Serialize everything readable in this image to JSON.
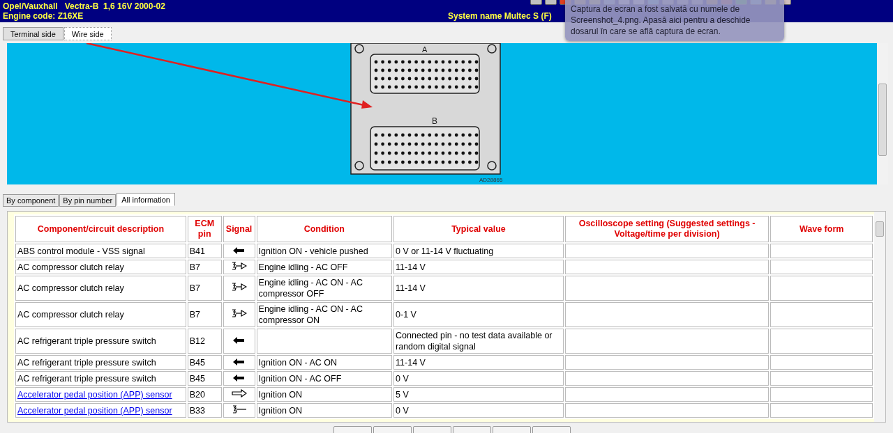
{
  "header": {
    "vehicle": "Opel/Vauxhall   Vectra-B  1,6 16V 2000-02",
    "engine_code": "Engine code: Z16XE",
    "system_name": "System name Multec S (F)"
  },
  "notification": {
    "text": "Captura de ecran a fost salvată cu numele de Screenshot_4.png. Apasă aici pentru a deschide dosarul în care se află captura de ecran."
  },
  "view_tabs": [
    {
      "label": "Terminal side",
      "selected": false
    },
    {
      "label": "Wire side",
      "selected": true
    }
  ],
  "connector": {
    "label_a": "A",
    "label_b": "B",
    "drawing_code": "AD28865"
  },
  "info_tabs": [
    {
      "label": "By component",
      "selected": false
    },
    {
      "label": "By pin number",
      "selected": false
    },
    {
      "label": "All information",
      "selected": true
    }
  ],
  "table": {
    "columns": [
      "Component/circuit description",
      "ECM pin",
      "Signal",
      "Condition",
      "Typical value",
      "Oscilloscope setting (Suggested settings - Voltage/time per division)",
      "Wave form"
    ],
    "rows": [
      {
        "description": "ABS control module - VSS signal",
        "link": false,
        "pin": "B41",
        "kind": "input",
        "condition": "Ignition ON - vehicle pushed",
        "typical": "0 V or 11-14 V fluctuating"
      },
      {
        "description": "AC compressor clutch relay",
        "link": false,
        "pin": "B7",
        "kind": "switched",
        "condition": "Engine idling - AC OFF",
        "typical": "11-14 V"
      },
      {
        "description": "AC compressor clutch relay",
        "link": false,
        "pin": "B7",
        "kind": "switched",
        "condition": "Engine idling - AC ON - AC compressor OFF",
        "typical": "11-14 V"
      },
      {
        "description": "AC compressor clutch relay",
        "link": false,
        "pin": "B7",
        "kind": "switched",
        "condition": "Engine idling - AC ON - AC compressor ON",
        "typical": "0-1 V"
      },
      {
        "description": "AC refrigerant triple pressure switch",
        "link": false,
        "pin": "B12",
        "kind": "input",
        "typical": "Connected pin - no test data available or random digital signal"
      },
      {
        "description": "AC refrigerant triple pressure switch",
        "link": false,
        "pin": "B45",
        "kind": "input",
        "condition": "Ignition ON - AC ON",
        "typical": "11-14 V"
      },
      {
        "description": "AC refrigerant triple pressure switch",
        "link": false,
        "pin": "B45",
        "kind": "input",
        "condition": "Ignition ON - AC OFF",
        "typical": "0 V"
      },
      {
        "description": "Accelerator pedal position (APP) sensor",
        "link": true,
        "pin": "B20",
        "kind": "supply",
        "condition": "Ignition ON",
        "typical": "5 V"
      },
      {
        "description": "Accelerator pedal position (APP) sensor",
        "link": true,
        "pin": "B33",
        "kind": "ground",
        "condition": "Ignition ON",
        "typical": "0 V"
      }
    ]
  }
}
